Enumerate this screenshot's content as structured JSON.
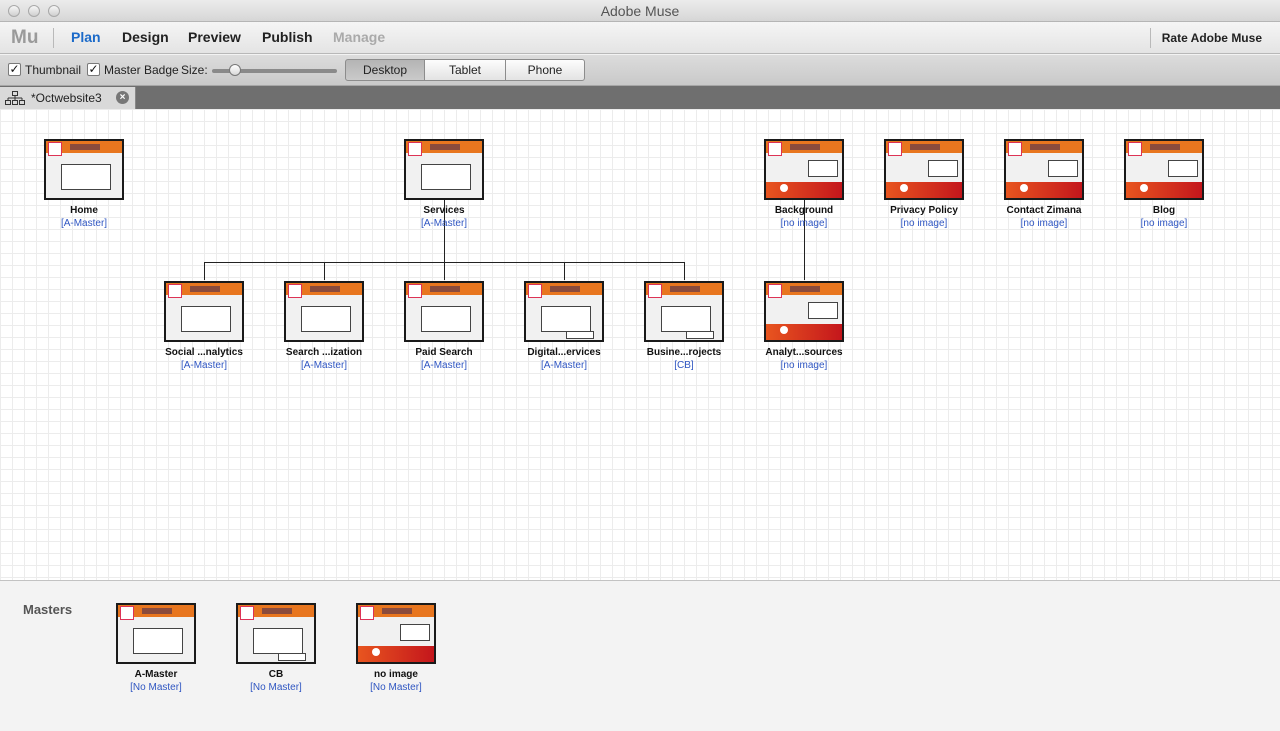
{
  "window": {
    "title": "Adobe Muse"
  },
  "menubar": {
    "logo": "Mu",
    "modes": [
      {
        "label": "Plan",
        "state": "active"
      },
      {
        "label": "Design",
        "state": "normal"
      },
      {
        "label": "Preview",
        "state": "normal"
      },
      {
        "label": "Publish",
        "state": "normal"
      },
      {
        "label": "Manage",
        "state": "disabled"
      }
    ],
    "rate_label": "Rate Adobe Muse"
  },
  "toolbar": {
    "thumbnail_label": "Thumbnail",
    "thumbnail_checked": true,
    "master_badge_label": "Master Badge",
    "master_badge_checked": true,
    "size_label": "Size:",
    "size_level": 0.15,
    "layouts": [
      {
        "label": "Desktop",
        "active": true
      },
      {
        "label": "Tablet",
        "active": false
      },
      {
        "label": "Phone",
        "active": false
      }
    ]
  },
  "document_tab": {
    "name": "*Octwebsite3",
    "icon": "sitemap-icon",
    "close_icon": "close-icon"
  },
  "sitemap": {
    "top_level": [
      {
        "name": "Home",
        "master": "[A-Master]"
      },
      {
        "name": "Services",
        "master": "[A-Master]"
      },
      {
        "name": "Background",
        "master": "[no image]"
      },
      {
        "name": "Privacy Policy",
        "master": "[no image]"
      },
      {
        "name": "Contact Zimana",
        "master": "[no image]"
      },
      {
        "name": "Blog",
        "master": "[no image]"
      }
    ],
    "services_children": [
      {
        "name": "Social ...nalytics",
        "master": "[A-Master]"
      },
      {
        "name": "Search ...ization",
        "master": "[A-Master]"
      },
      {
        "name": "Paid Search",
        "master": "[A-Master]"
      },
      {
        "name": "Digital...ervices",
        "master": "[A-Master]"
      },
      {
        "name": "Busine...rojects",
        "master": "[CB]"
      }
    ],
    "background_children": [
      {
        "name": "Analyt...sources",
        "master": "[no image]"
      }
    ]
  },
  "masters_panel": {
    "title": "Masters",
    "items": [
      {
        "name": "A-Master",
        "master": "[No Master]"
      },
      {
        "name": "CB",
        "master": "[No Master]"
      },
      {
        "name": "no image",
        "master": "[No Master]"
      }
    ]
  },
  "colors": {
    "accent": "#1b6ac9",
    "link": "#2f56c2",
    "thumb_orange": "#e8761f",
    "thumb_red": "#c4161c"
  }
}
